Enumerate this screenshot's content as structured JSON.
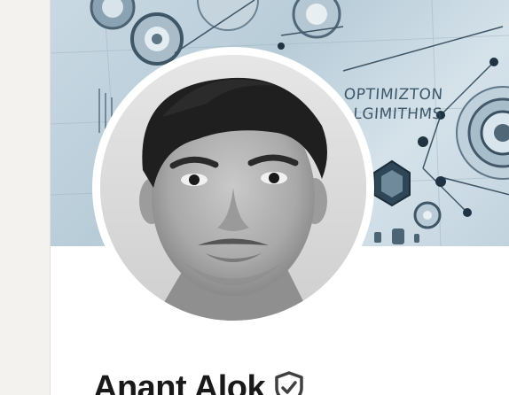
{
  "profile": {
    "name": "Anant Alok",
    "verified_icon": "shield-check-icon"
  },
  "banner": {
    "line1": "OPTIMIZTON",
    "line2": "ALGIMITHMS",
    "background_color": "#c9d9e3"
  },
  "avatar": {
    "icon": "profile-photo"
  },
  "colors": {
    "page_bg": "#f4f2ee",
    "card_bg": "#ffffff",
    "name_text": "#191919"
  }
}
